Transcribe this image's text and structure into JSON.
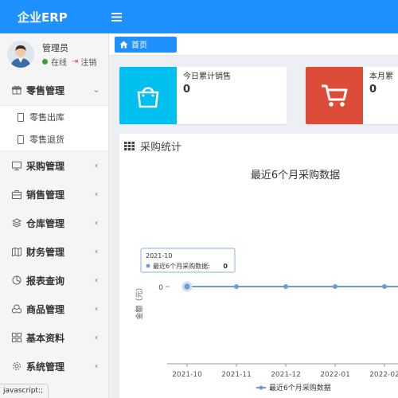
{
  "app": {
    "title": "企业ERP"
  },
  "user": {
    "name": "管理员",
    "status": "在线",
    "logout": "注销"
  },
  "sidebar": {
    "items": [
      {
        "label": "零售管理",
        "icon": "gift-icon",
        "expanded": true,
        "children": [
          {
            "label": "零售出库"
          },
          {
            "label": "零售退货"
          }
        ]
      },
      {
        "label": "采购管理",
        "icon": "monitor-icon"
      },
      {
        "label": "销售管理",
        "icon": "briefcase-icon"
      },
      {
        "label": "仓库管理",
        "icon": "layers-icon"
      },
      {
        "label": "财务管理",
        "icon": "map-icon"
      },
      {
        "label": "报表查询",
        "icon": "pie-icon"
      },
      {
        "label": "商品管理",
        "icon": "cubes-icon"
      },
      {
        "label": "基本资料",
        "icon": "grid-icon"
      },
      {
        "label": "系统管理",
        "icon": "gear-icon"
      }
    ]
  },
  "tabs": {
    "home": "首页"
  },
  "cards": [
    {
      "title": "今日累计销售",
      "value": "0",
      "icon": "shopping-bag-icon",
      "color": "#00c0ef"
    },
    {
      "title": "本月累",
      "value": "0",
      "icon": "shopping-cart-icon",
      "color": "#dd4b39"
    }
  ],
  "panel": {
    "title": "采购统计"
  },
  "chart_data": {
    "type": "line",
    "title": "最近6个月采购数据",
    "ylabel": "金额（元）",
    "categories": [
      "2021-10",
      "2021-11",
      "2021-12",
      "2022-01",
      "2022-02"
    ],
    "series": [
      {
        "name": "最近6个月采购数据",
        "values": [
          0,
          0,
          0,
          0,
          0
        ]
      }
    ],
    "y_tick": "0",
    "tooltip": {
      "title": "2021-10",
      "label": "最近6个月采购数据:",
      "value": "0"
    },
    "color": "#6e9bd6"
  },
  "status_bar": {
    "text": "javascript:;"
  }
}
